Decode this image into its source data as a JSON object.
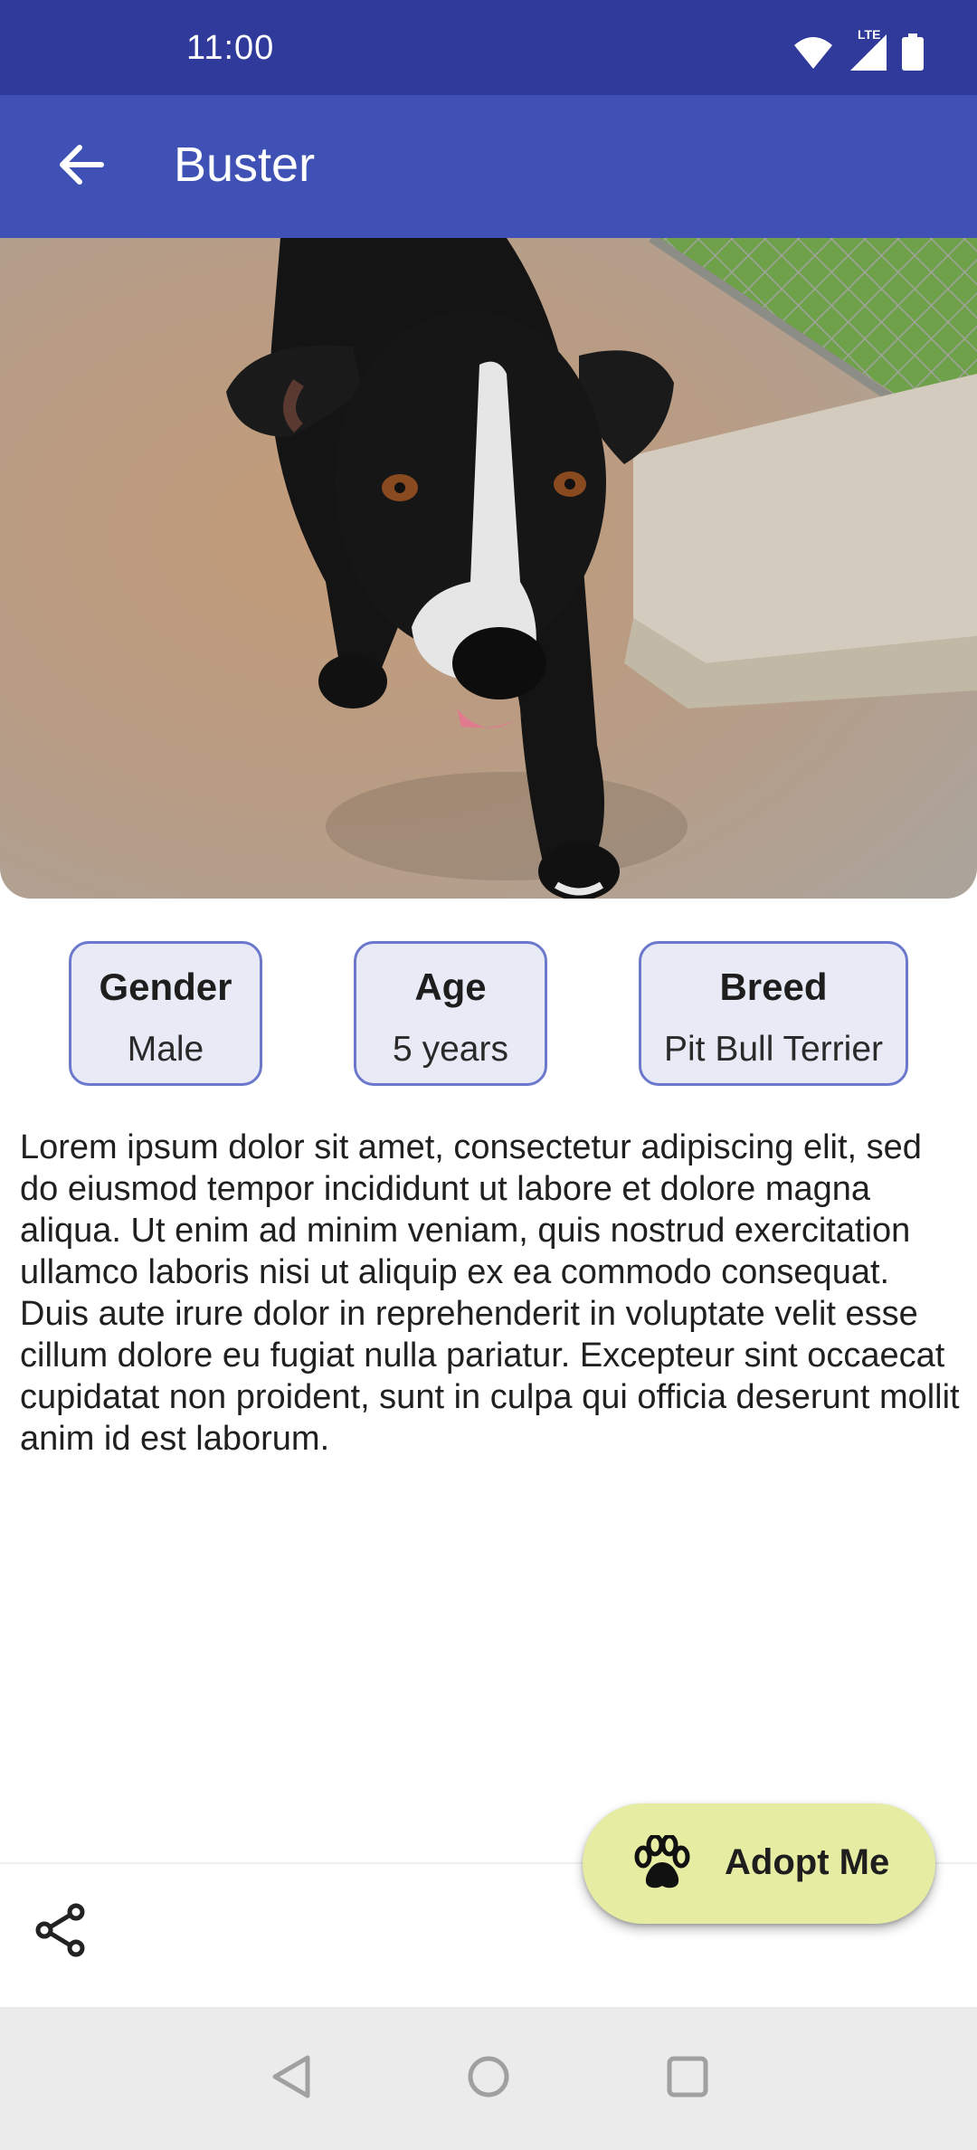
{
  "status_bar": {
    "time": "11:00",
    "network": "LTE",
    "icons": [
      "wifi-icon",
      "cellular-icon",
      "battery-icon"
    ]
  },
  "app_bar": {
    "title": "Buster",
    "back_icon": "arrow-back-icon"
  },
  "pet": {
    "photo_alt": "Black dog with white chest blaze on concrete",
    "info": [
      {
        "title": "Gender",
        "value": "Male"
      },
      {
        "title": "Age",
        "value": "5 years"
      },
      {
        "title": "Breed",
        "value": "Pit Bull Terrier"
      }
    ],
    "description": "Lorem ipsum dolor sit amet, consectetur adipiscing elit, sed do eiusmod tempor incididunt ut labore et dolore magna aliqua. Ut enim ad minim veniam, quis nostrud exercitation ullamco laboris nisi ut aliquip ex ea commodo consequat. Duis aute irure dolor in reprehenderit in voluptate velit esse cillum dolore eu fugiat nulla pariatur. Excepteur sint occaecat cupidatat non proident, sunt in culpa qui officia deserunt mollit anim id est laborum."
  },
  "fab": {
    "label": "Adopt Me",
    "icon": "paw-icon"
  },
  "bottom_bar": {
    "share_icon": "share-icon"
  },
  "nav_bar": {
    "buttons": [
      "back-nav-icon",
      "home-nav-icon",
      "recents-nav-icon"
    ]
  },
  "colors": {
    "status_bar": "#2f3a9a",
    "app_bar": "#3f51b5",
    "chip_border": "#6b78cc",
    "chip_bg": "#e8eaf6",
    "fab_bg": "#e6eda2",
    "nav_bar": "#ebebeb"
  }
}
